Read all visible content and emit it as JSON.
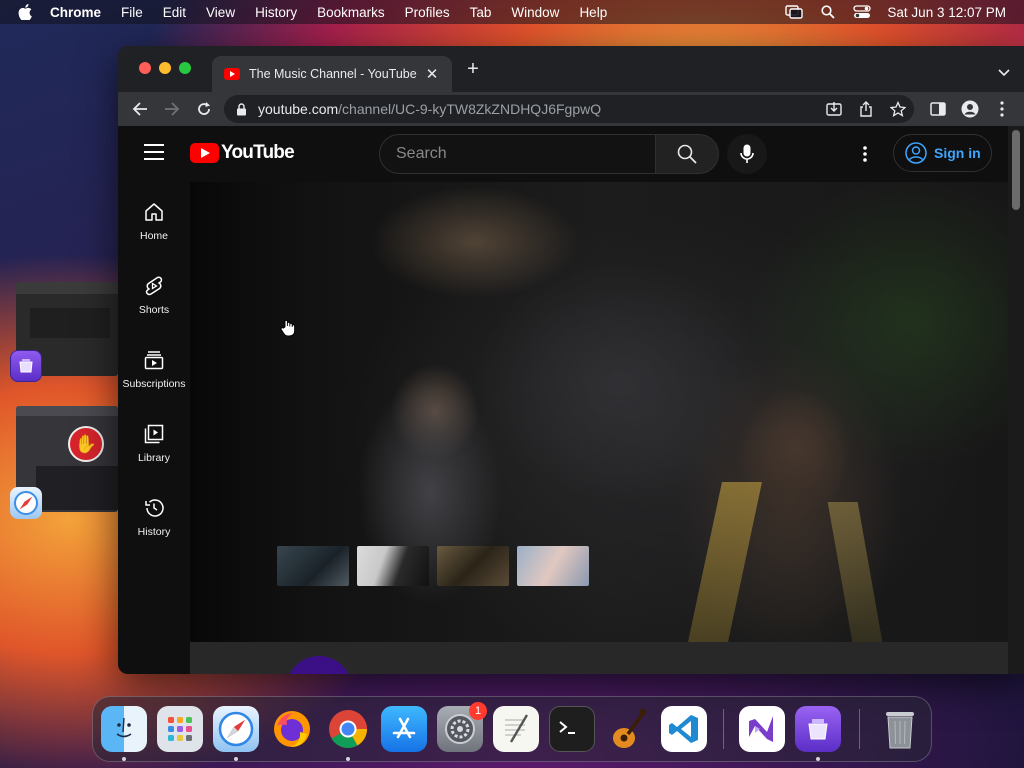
{
  "menubar": {
    "app_name": "Chrome",
    "items": [
      "File",
      "Edit",
      "View",
      "History",
      "Bookmarks",
      "Profiles",
      "Tab",
      "Window",
      "Help"
    ],
    "clock": "Sat Jun 3  12:07 PM"
  },
  "browser": {
    "tab_title": "The Music Channel - YouTube",
    "new_tab_label": "+",
    "close_label": "✕",
    "url_host": "youtube.com",
    "url_path": "/channel/UC-9-kyTW8ZkZNDHQJ6FgpwQ"
  },
  "youtube": {
    "logo_text": "YouTube",
    "search_placeholder": "Search",
    "sign_in_label": "Sign in",
    "sidebar": [
      {
        "label": "Home",
        "icon": "home-icon"
      },
      {
        "label": "Shorts",
        "icon": "shorts-icon"
      },
      {
        "label": "Subscriptions",
        "icon": "subscriptions-icon"
      },
      {
        "label": "Library",
        "icon": "library-icon"
      },
      {
        "label": "History",
        "icon": "history-icon"
      }
    ]
  },
  "dock": {
    "apps": [
      "Finder",
      "Launchpad",
      "Safari",
      "Firefox",
      "Google Chrome",
      "App Store",
      "System Settings",
      "TextEdit",
      "Terminal",
      "GarageBand",
      "Visual Studio Code",
      "Visual Studio",
      "Simulator",
      "Trash"
    ],
    "settings_badge": "1"
  },
  "colors": {
    "youtube_red": "#ff0000",
    "signin_blue": "#3ea6ff",
    "chrome_dark": "#202124"
  }
}
